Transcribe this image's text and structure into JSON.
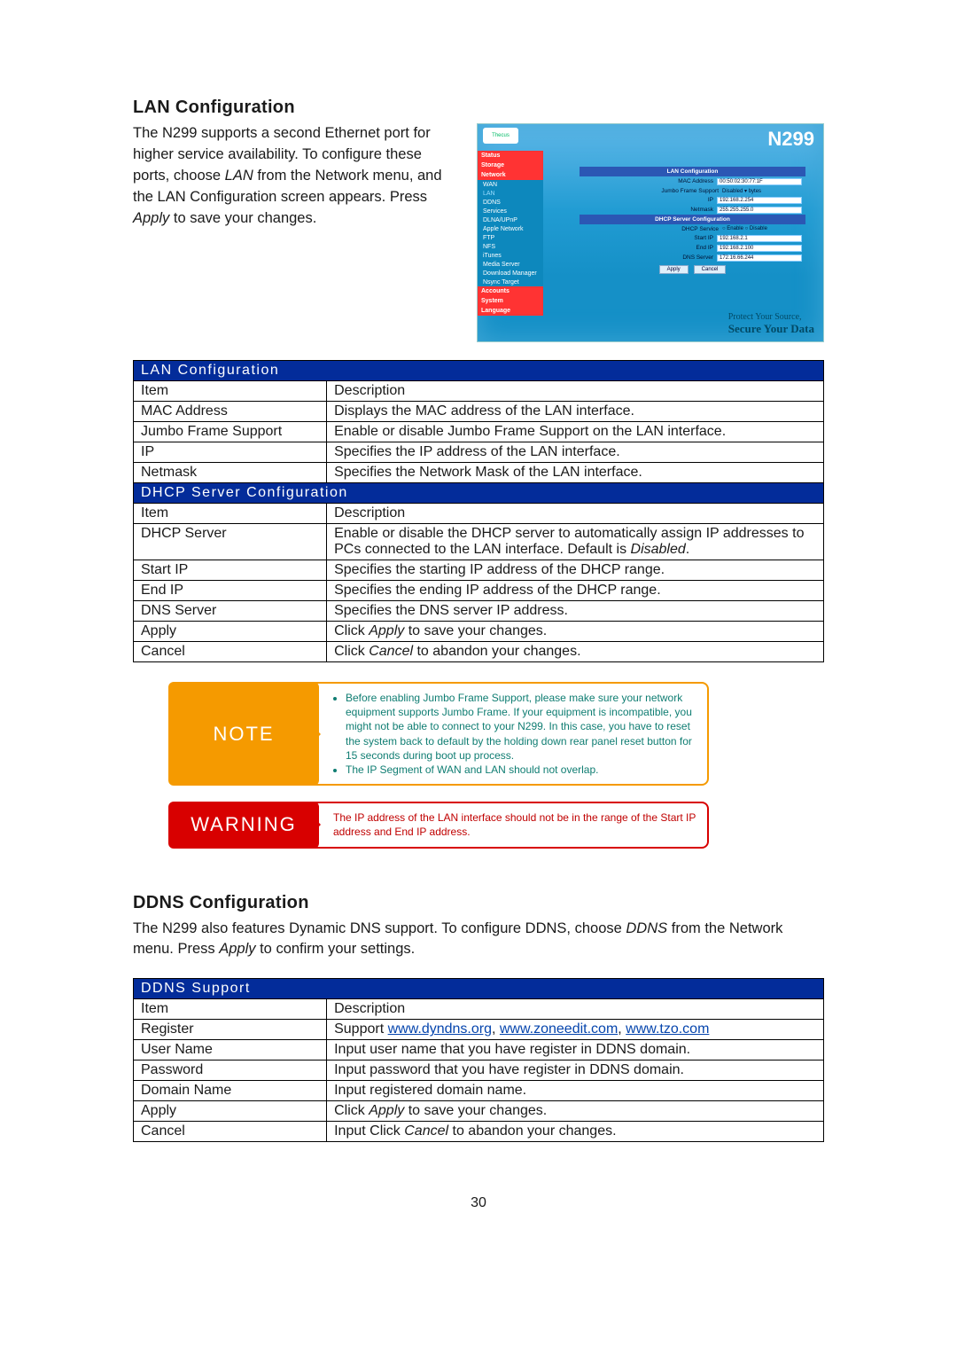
{
  "page_number": "30",
  "lan": {
    "heading": "LAN Configuration",
    "intro_before_lan": "The N299 supports a second Ethernet port for higher service availability. To configure these ports, choose ",
    "intro_lan_word": "LAN",
    "intro_between": " from the Network menu, and the LAN Configuration screen appears. Press ",
    "intro_apply_word": "Apply",
    "intro_after": " to save your changes."
  },
  "shot": {
    "logo": "Thecus",
    "model": "N299",
    "menu_sections": [
      "Status",
      "Storage",
      "Network",
      "Accounts",
      "System",
      "Language"
    ],
    "menu_items": [
      "WAN",
      "LAN",
      "DDNS",
      "Services",
      "DLNA/UPnP",
      "Apple Network",
      "FTP",
      "NFS",
      "iTunes",
      "Media Server",
      "Download Manager",
      "Nsync Target"
    ],
    "panel_lan_hdr": "LAN Configuration",
    "mac_lbl": "MAC Address",
    "mac_val": "00:50:02:30:77:1F",
    "jumbo_lbl": "Jumbo Frame Support",
    "jumbo_val": "Disabled ▾ bytes",
    "ip_lbl": "IP",
    "ip_val": "192.168.2.254",
    "nm_lbl": "Netmask",
    "nm_val": "255.255.255.0",
    "panel_dhcp_hdr": "DHCP Server Configuration",
    "dhcp_lbl": "DHCP Service",
    "dhcp_val": "○ Enable  ○ Disable",
    "sip_lbl": "Start IP",
    "sip_val": "192.168.2.1",
    "eip_lbl": "End IP",
    "eip_val": "192.168.2.100",
    "dns_lbl": "DNS Server",
    "dns_val": "172.16.66.244",
    "apply_btn": "Apply",
    "cancel_btn": "Cancel",
    "footer_a": "Protect Your Source,",
    "footer_b": "Secure Your Data"
  },
  "lan_table": {
    "title": "LAN Configuration",
    "h1": "Item",
    "h2": "Description",
    "rows": [
      [
        "MAC Address",
        "Displays the MAC address of the LAN interface."
      ],
      [
        "Jumbo Frame Support",
        "Enable or disable Jumbo Frame Support on the LAN interface."
      ],
      [
        "IP",
        "Specifies the IP address of the LAN interface."
      ],
      [
        "Netmask",
        "Specifies the Network Mask of the LAN interface."
      ]
    ],
    "sub_title": "DHCP Server Configuration",
    "sub_h1": "Item",
    "sub_h2": "Description",
    "dhcp_row_item": "DHCP Server",
    "dhcp_row_desc_a": "Enable or disable the DHCP server to automatically assign IP addresses to PCs connected to the LAN interface. Default is ",
    "dhcp_row_desc_b": "Disabled",
    "dhcp_row_desc_c": ".",
    "rows2": [
      [
        "Start IP",
        "Specifies the starting IP address of the DHCP range."
      ],
      [
        "End IP",
        "Specifies the ending IP address of the DHCP range."
      ],
      [
        "DNS Server",
        "Specifies the DNS server IP address."
      ]
    ],
    "apply_item": "Apply",
    "apply_desc_a": "Click ",
    "apply_desc_b": "Apply",
    "apply_desc_c": " to save your changes.",
    "cancel_item": "Cancel",
    "cancel_desc_a": "Click ",
    "cancel_desc_b": "Cancel",
    "cancel_desc_c": " to abandon your changes."
  },
  "note": {
    "tag": "NOTE",
    "li1": "Before enabling Jumbo Frame Support, please make sure your network equipment supports Jumbo Frame. If your equipment is incompatible, you might not be able to connect to your N299. In this case, you have to reset the system back to default by the holding down rear panel reset button for 15 seconds during boot up process.",
    "li2": "The IP Segment of WAN and LAN should not overlap."
  },
  "warn": {
    "tag": "WARNING",
    "text": "The IP address of the LAN interface should not be in the range of the Start IP address and End IP address."
  },
  "ddns": {
    "heading": "DDNS Configuration",
    "intro_a": "The N299 also features Dynamic DNS support. To configure DDNS, choose ",
    "intro_b": "DDNS",
    "intro_c": " from the Network menu. Press ",
    "intro_d": "Apply",
    "intro_e": " to confirm your settings."
  },
  "ddns_table": {
    "title": "DDNS Support",
    "h1": "Item",
    "h2": "Description",
    "reg_item": "Register",
    "reg_a": "Support ",
    "reg_l1": "www.dyndns.org",
    "reg_s1": ", ",
    "reg_l2": "www.zoneedit.com",
    "reg_s2": ", ",
    "reg_l3": "www.tzo.com",
    "rows": [
      [
        "User Name",
        "Input user name that you have register in DDNS domain."
      ],
      [
        "Password",
        "Input password that you have register in DDNS domain."
      ],
      [
        "Domain Name",
        "Input registered domain name."
      ]
    ],
    "apply_item": "Apply",
    "apply_a": "Click ",
    "apply_b": "Apply",
    "apply_c": " to save your changes.",
    "cancel_item": "Cancel",
    "cancel_a": "Input Click ",
    "cancel_b": "Cancel",
    "cancel_c": " to abandon your changes."
  }
}
